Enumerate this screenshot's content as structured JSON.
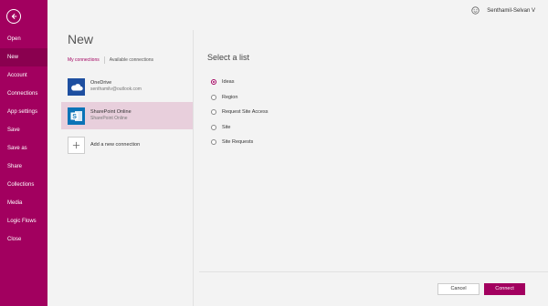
{
  "sidebar": {
    "items": [
      {
        "label": "Open",
        "active": false
      },
      {
        "label": "New",
        "active": true
      },
      {
        "label": "Account",
        "active": false
      },
      {
        "label": "Connections",
        "active": false
      },
      {
        "label": "App settings",
        "active": false
      },
      {
        "label": "Save",
        "active": false
      },
      {
        "label": "Save as",
        "active": false
      },
      {
        "label": "Share",
        "active": false
      },
      {
        "label": "Collections",
        "active": false
      },
      {
        "label": "Media",
        "active": false
      },
      {
        "label": "Logic Flows",
        "active": false
      },
      {
        "label": "Close",
        "active": false
      }
    ]
  },
  "header": {
    "user_name": "Senthamil-Selvan V",
    "user_icon": "smile-icon"
  },
  "panel": {
    "title": "New",
    "tabs": {
      "mine": "My connections",
      "available": "Available connections"
    },
    "connections": [
      {
        "name": "OneDrive",
        "sub": "senthamilv@outlook.com",
        "icon": "onedrive-icon"
      },
      {
        "name": "SharePoint Online",
        "sub": "SharePoint Online",
        "icon": "sharepoint-icon",
        "selected": true
      }
    ],
    "add_label": "Add a new connection"
  },
  "lists": {
    "title": "Select a list",
    "options": [
      {
        "label": "Ideas",
        "checked": true
      },
      {
        "label": "Region",
        "checked": false
      },
      {
        "label": "Request Site Access",
        "checked": false
      },
      {
        "label": "Site",
        "checked": false
      },
      {
        "label": "Site Requests",
        "checked": false
      }
    ]
  },
  "actions": {
    "cancel": "Cancel",
    "connect": "Connect"
  },
  "colors": {
    "accent": "#a2005f",
    "selected_row": "#e8cfdc"
  }
}
